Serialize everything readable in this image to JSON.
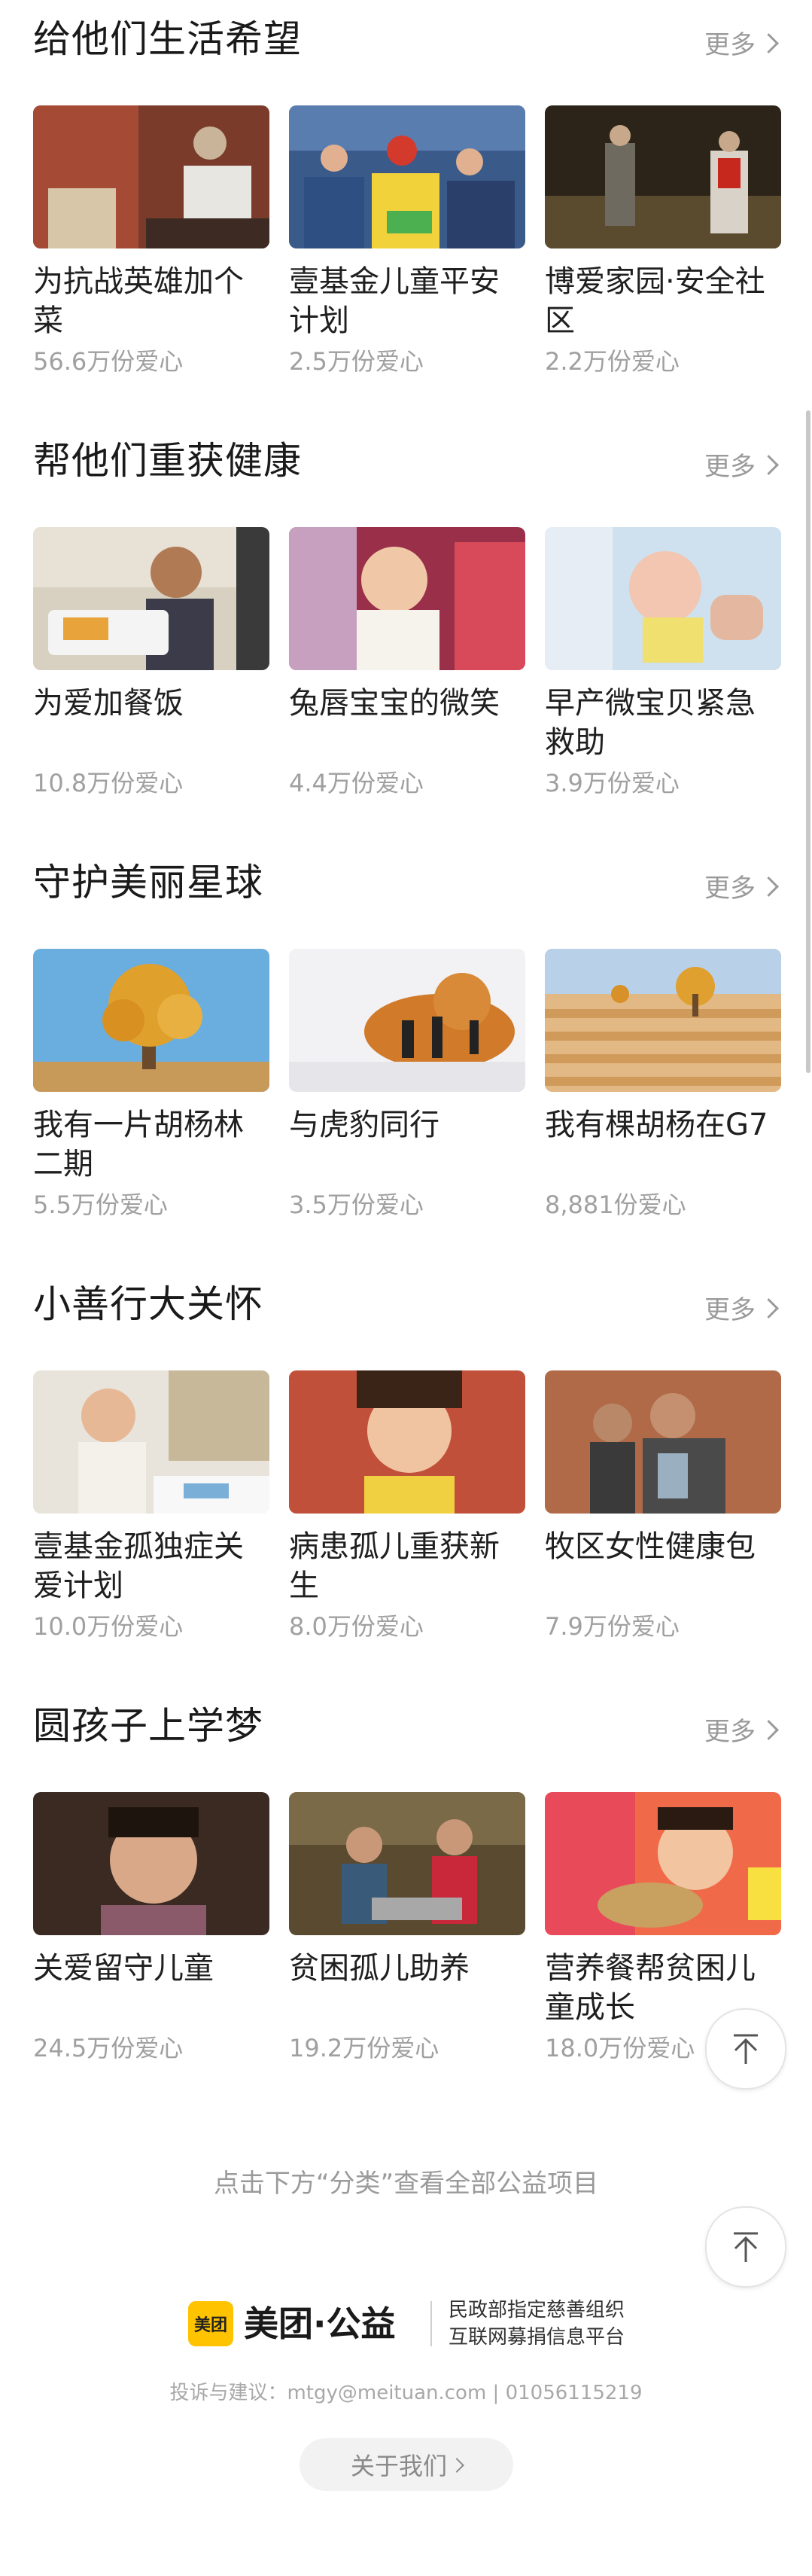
{
  "common": {
    "more_label": "更多"
  },
  "sections": [
    {
      "title": "给他们生活希望",
      "items": [
        {
          "title": "为抗战英雄加个菜",
          "love": "56.6万份爱心"
        },
        {
          "title": "壹基金儿童平安计划",
          "love": "2.5万份爱心"
        },
        {
          "title": "博爱家园·安全社区",
          "love": "2.2万份爱心"
        }
      ]
    },
    {
      "title": "帮他们重获健康",
      "items": [
        {
          "title": "为爱加餐饭",
          "love": "10.8万份爱心"
        },
        {
          "title": "兔唇宝宝的微笑",
          "love": "4.4万份爱心"
        },
        {
          "title": "早产微宝贝紧急救助",
          "love": "3.9万份爱心"
        }
      ]
    },
    {
      "title": "守护美丽星球",
      "items": [
        {
          "title": "我有一片胡杨林二期",
          "love": "5.5万份爱心"
        },
        {
          "title": "与虎豹同行",
          "love": "3.5万份爱心"
        },
        {
          "title": "我有棵胡杨在G7",
          "love": "8,881份爱心"
        }
      ]
    },
    {
      "title": "小善行大关怀",
      "items": [
        {
          "title": "壹基金孤独症关爱计划",
          "love": "10.0万份爱心"
        },
        {
          "title": "病患孤儿重获新生",
          "love": "8.0万份爱心"
        },
        {
          "title": "牧区女性健康包",
          "love": "7.9万份爱心"
        }
      ]
    },
    {
      "title": "圆孩子上学梦",
      "items": [
        {
          "title": "关爱留守儿童",
          "love": "24.5万份爱心"
        },
        {
          "title": "贫困孤儿助养",
          "love": "19.2万份爱心"
        },
        {
          "title": "营养餐帮贫困儿童成长",
          "love": "18.0万份爱心"
        }
      ]
    }
  ],
  "footer": {
    "hint": "点击下方“分类”查看全部公益项目",
    "brand_badge": "美团",
    "brand_name": "美团·公益",
    "brand_desc_line1": "民政部指定慈善组织",
    "brand_desc_line2": "互联网募捐信息平台",
    "contact": "投诉与建议：mtgy@meituan.com | 01056115219",
    "about_label": "关于我们"
  },
  "colors": {
    "brand_yellow": "#ffc300",
    "muted_text": "#9a9a9a"
  }
}
